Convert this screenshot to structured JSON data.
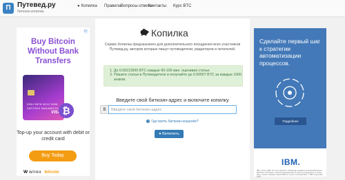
{
  "header": {
    "brand_title": "Путевед.ру",
    "brand_subtitle": "биткоин-копилка",
    "nav": [
      "Копилка",
      "Правила",
      "Вопросы-ответы",
      "Контакты",
      "Курс BTC"
    ]
  },
  "ad_left": {
    "headline": "Buy Bitcoin Without Bank Transfers",
    "card_number": "5354 5678 9012 3456",
    "card_holder": "SATOSHI NAKAMOTO",
    "card_brand": "VISA",
    "body": "Top-up your account with debit or credit card",
    "button": "Buy Today",
    "footer_brand": "wirex",
    "footer_partner": "bitcoin"
  },
  "main": {
    "title": "Копилка",
    "intro": "Сервис Копилка предназначен для дополнительного поощрения всех участников Путевед.ру, авторов которые пишут путеводители, редакторов и читателей.",
    "rules": [
      "До 0.00213650 BTC каждые 60-100 мин. оценивая статьи.",
      "Пишите статьи в Путеводителе и получайте до 0.00007 BTC за каждые 1000 знаков."
    ],
    "section_heading": "Введите свой биткоин-адрес и включите копилку",
    "input_addon": "B",
    "input_placeholder": "Введите свой биткоин-адрес",
    "help_link": "Где взять биткоин-кошелёк?",
    "enable_button": "Включить"
  },
  "ad_right": {
    "headline": "Сделайте первый шаг к стратегии автоматизации процессов.",
    "button": "Подробнее",
    "brand": "IBM.",
    "legal": "IBM, логотип IBM, ibm.com являются товарными знаками International Business Machines Corporation, зарегистрированными во многих юрисдикциях по всему миру. Список товарных знаков IBM см. на ibm.com/trademark. © IBM Corporation 2019."
  },
  "colors": {
    "accent": "#337ab7",
    "alert_bg": "#dff0d8",
    "ad_left_purple": "#8a4fd4",
    "ad_left_orange": "#f39c12",
    "ad_right_blue": "#4379b8"
  }
}
